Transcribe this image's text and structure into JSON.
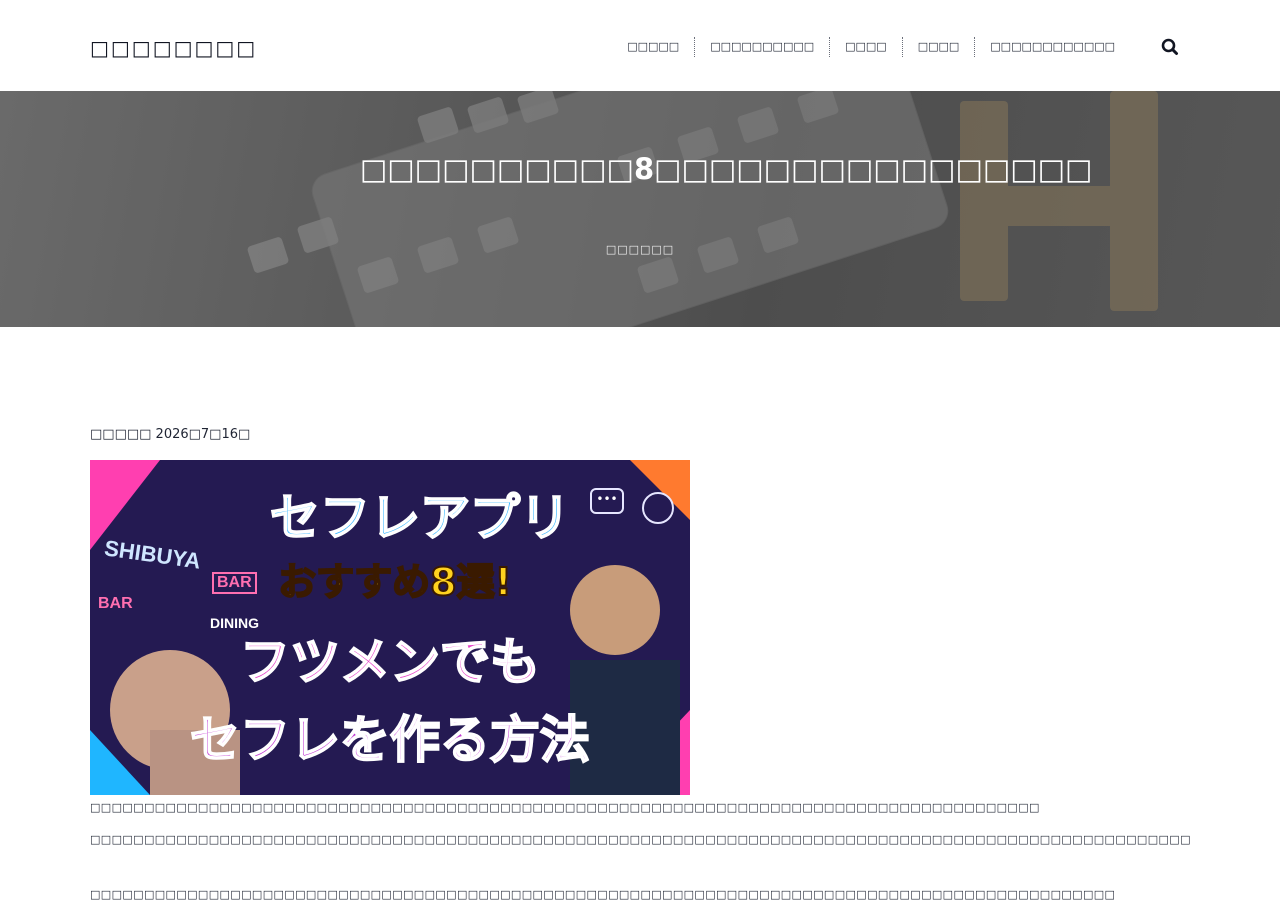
{
  "site": {
    "title": "□□□□□□□□"
  },
  "nav": {
    "items": [
      {
        "label": "□□□□□"
      },
      {
        "label": "□□□□□□□□□□"
      },
      {
        "label": "□□□□"
      },
      {
        "label": "□□□□"
      },
      {
        "label": "□□□□□□□□□□□□"
      }
    ],
    "search_icon": "search-icon"
  },
  "hero": {
    "title": "□□□□□□□□□□8□□□□□□□□□□□□□□□□",
    "meta": "□□□□□□"
  },
  "post": {
    "date": "□□□□□ 2026□7□16□",
    "image": {
      "lines": [
        "セフレアプリ",
        "おすすめ8選!",
        "フツメンでも",
        "セフレを作る方法"
      ],
      "signs": [
        "SHIBUYA",
        "BAR",
        "BAR",
        "DINING"
      ]
    },
    "paragraphs": [
      "□□□□□□□□□□□□□□□□□□□□□□□□□□□□□□□□□□□□□□□□□□□□□□□□□□□□□□□□□□□□□□□□□□□□□□□□□□□□□□□□□□□□□□□□",
      "□□□□□□□□□□□□□□□□□□□□□□□□□□□□□□□□□□□□□□□□□□□□□□□□□□□□□□□□□□□□□□□□□□□□□□□□□□□□□□□□□□□□□□□□□□□□□□□□□□□□□□□□□□□□□□□□□□□□□□□□□□□□□□□□□□□□□□□□□□□□□□□□□□□□□□□□□□□□",
      "□□□□□□□□□□□□□□□□□□□□□□□□□□□□□□□□□□□□□□□□□□□□□□□□□□□□□□□□□□□□□□□□□□□□□□□□□□□□□□□□□□□□□□□□□□□□□□□"
    ]
  },
  "colors": {
    "text": "#1f2433",
    "hero_overlay": "#595959",
    "accent_pink": "#ff3fb0",
    "accent_yellow": "#ffd21f"
  }
}
